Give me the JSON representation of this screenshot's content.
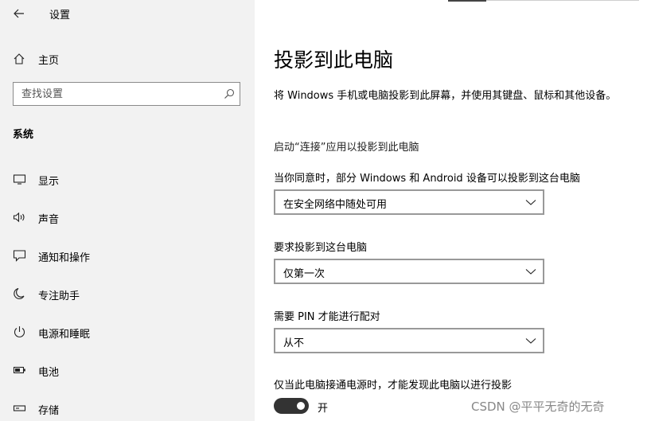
{
  "app": {
    "title": "设置"
  },
  "sidebar": {
    "home_label": "主页",
    "search_placeholder": "查找设置",
    "section_title": "系统",
    "items": [
      {
        "label": "显示",
        "icon": "monitor-icon"
      },
      {
        "label": "声音",
        "icon": "speaker-icon"
      },
      {
        "label": "通知和操作",
        "icon": "notification-icon"
      },
      {
        "label": "专注助手",
        "icon": "moon-icon"
      },
      {
        "label": "电源和睡眠",
        "icon": "power-icon"
      },
      {
        "label": "电池",
        "icon": "battery-icon"
      },
      {
        "label": "存储",
        "icon": "storage-icon"
      }
    ]
  },
  "main": {
    "title": "投影到此电脑",
    "description": "将 Windows 手机或电脑投影到此屏幕，并使用其键盘、鼠标和其他设备。",
    "link": "启动“连接”应用以投影到此电脑",
    "fields": [
      {
        "label": "当你同意时，部分 Windows 和 Android 设备可以投影到这台电脑",
        "value": "在安全网络中随处可用"
      },
      {
        "label": "要求投影到这台电脑",
        "value": "仅第一次"
      },
      {
        "label": "需要 PIN 才能进行配对",
        "value": "从不"
      }
    ],
    "power_label": "仅当此电脑接通电源时，才能发现此电脑以进行投影",
    "toggle_state": "开"
  },
  "watermark": "CSDN @平平无奇的无奇"
}
